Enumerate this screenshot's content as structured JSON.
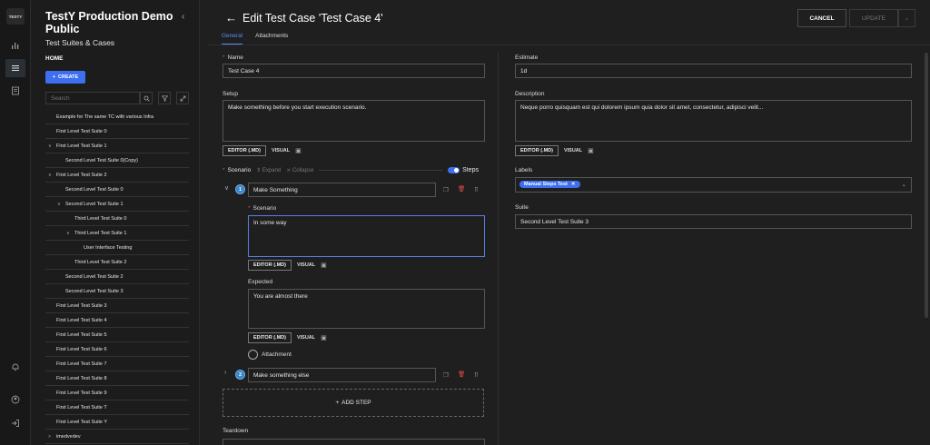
{
  "app": {
    "logo": "TESTY"
  },
  "sidebar": {
    "title": "TestY Production Demo Public",
    "subtitle": "Test Suites & Cases",
    "home": "HOME",
    "create": "CREATE",
    "search_placeholder": "Search",
    "items": [
      {
        "label": "Example for The same TC with various Infra",
        "chev": ""
      },
      {
        "label": "First Level Test Suite 0",
        "chev": ""
      },
      {
        "label": "First Level Test Suite 1",
        "chev": "∨"
      },
      {
        "label": "Second Level Test Suite 0(Copy)",
        "chev": ""
      },
      {
        "label": "First Level Test Suite 2",
        "chev": "∨"
      },
      {
        "label": "Second Level Test Suite 0",
        "chev": ""
      },
      {
        "label": "Second Level Test Suite 1",
        "chev": "∨"
      },
      {
        "label": "Third Level Test Suite 0",
        "chev": ""
      },
      {
        "label": "Third Level Test Suite 1",
        "chev": "∨"
      },
      {
        "label": "User Interface Testing",
        "chev": ""
      },
      {
        "label": "Third Level Test Suite 2",
        "chev": ""
      },
      {
        "label": "Second Level Test Suite 2",
        "chev": ""
      },
      {
        "label": "Second Level Test Suite 3",
        "chev": ""
      },
      {
        "label": "First Level Test Suite 3",
        "chev": ""
      },
      {
        "label": "First Level Test Suite 4",
        "chev": ""
      },
      {
        "label": "First Level Test Suite 5",
        "chev": ""
      },
      {
        "label": "First Level Test Suite 6",
        "chev": ""
      },
      {
        "label": "First Level Test Suite 7",
        "chev": ""
      },
      {
        "label": "First Level Test Suite 8",
        "chev": ""
      },
      {
        "label": "First Level Test Suite 9",
        "chev": ""
      },
      {
        "label": "First Level Test Suite T",
        "chev": ""
      },
      {
        "label": "First Level Test Suite Y",
        "chev": ""
      },
      {
        "label": "imedvedev",
        "chev": ">"
      }
    ]
  },
  "header": {
    "title": "Edit Test Case 'Test Case 4'",
    "cancel": "CANCEL",
    "update": "UPDATE",
    "tabs": [
      "General",
      "Attachments"
    ]
  },
  "form": {
    "name_label": "Name",
    "name_value": "Test Case 4",
    "setup_label": "Setup",
    "setup_value": "Make something before you start execution scenario.",
    "editor_md": "EDITOR (.MD)",
    "visual": "VISUAL",
    "scenario_label": "Scenario",
    "expand": "Expand",
    "collapse": "Collapse",
    "steps_label": "Steps",
    "step1_num": "1",
    "step1_value": "Make Something",
    "step1_scenario_label": "Scenario",
    "step1_scenario_value": "In some way",
    "step1_expected_label": "Expected",
    "step1_expected_value": "You are almost there",
    "step1_attachment": "Attachment",
    "step2_num": "2",
    "step2_value": "Make something else",
    "add_step": "ADD STEP",
    "teardown_label": "Teardown",
    "estimate_label": "Estimate",
    "estimate_value": "1d",
    "description_label": "Description",
    "description_value": "Neque porro quisquam est qui dolorem ipsum quia dolor sit amet, consectetur, adipisci velit...",
    "labels_label": "Labels",
    "labels_tag": "Manual Steps Test",
    "suite_label": "Suite",
    "suite_value": "Second Level Test Suite 3"
  },
  "colors": {
    "accent": "#3d6ff0",
    "required": "#e04b4b"
  }
}
